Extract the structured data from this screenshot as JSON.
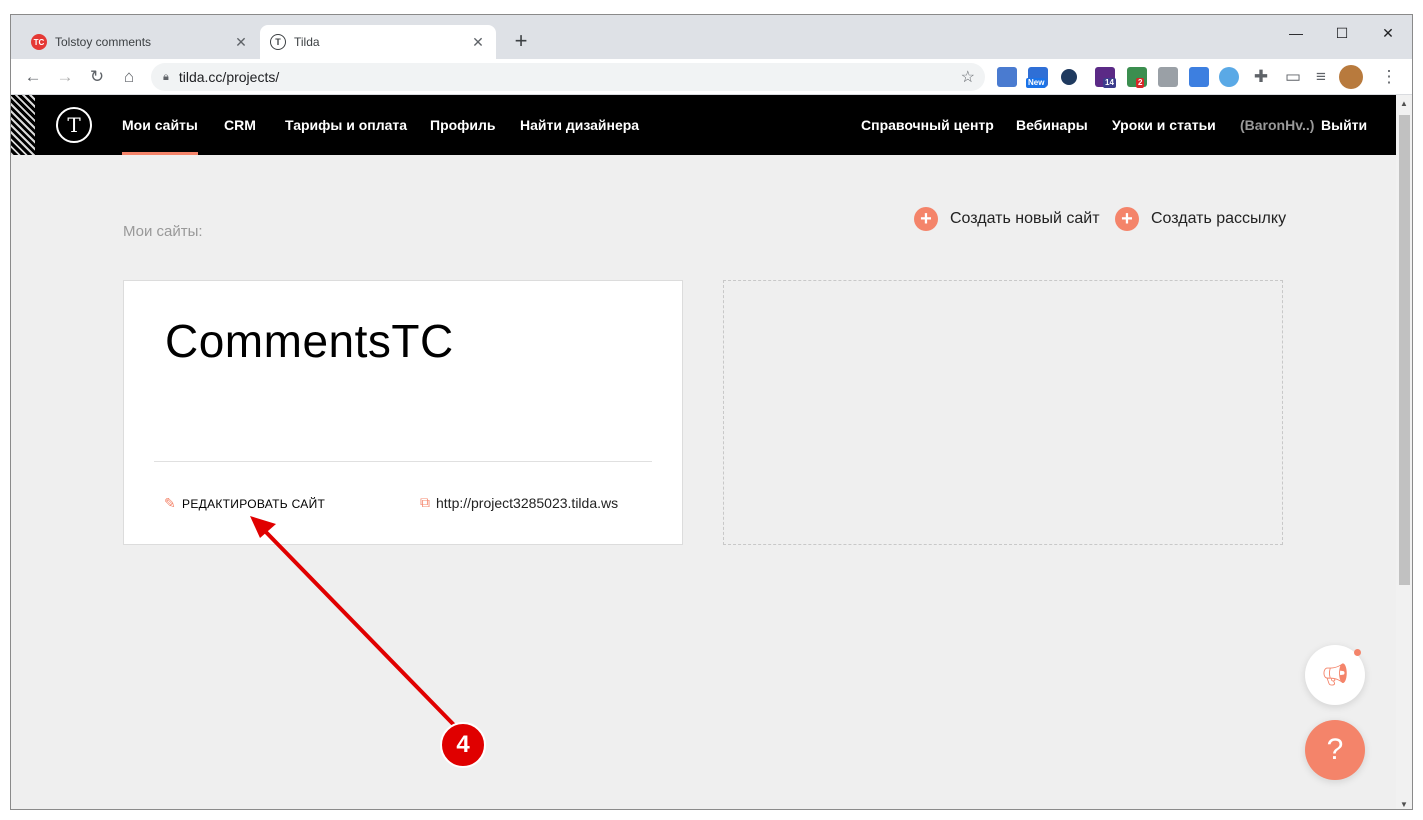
{
  "browser": {
    "tabs": [
      {
        "title": "Tolstoy comments",
        "favicon_text": "TC",
        "active": false
      },
      {
        "title": "Tilda",
        "favicon_text": "T",
        "active": true
      }
    ],
    "new_tab_label": "+",
    "url": "tilda.cc/projects/",
    "extension_badges": {
      "new": "New",
      "count_14": "14",
      "count_2": "2"
    },
    "window_controls": {
      "minimize": "—",
      "maximize": "☐",
      "close": "✕"
    }
  },
  "header": {
    "logo_glyph": "T",
    "nav_left": [
      "Мои сайты",
      "CRM",
      "Тарифы и оплата",
      "Профиль",
      "Найти дизайнера"
    ],
    "nav_right": [
      "Справочный центр",
      "Вебинары",
      "Уроки и статьи"
    ],
    "user": "(BaronHv..)",
    "logout": "Выйти"
  },
  "content": {
    "section_label": "Мои сайты:",
    "create_site": "Создать новый сайт",
    "create_mailing": "Создать рассылку",
    "project": {
      "title": "CommentsTC",
      "edit_label": "РЕДАКТИРОВАТЬ САЙТ",
      "url": "http://project3285023.tilda.ws"
    },
    "help_glyph": "?"
  },
  "annotation": {
    "step_number": "4",
    "color": "#e00000"
  },
  "colors": {
    "accent": "#f4846a",
    "header_bg": "#000000",
    "page_bg": "#efefef"
  }
}
